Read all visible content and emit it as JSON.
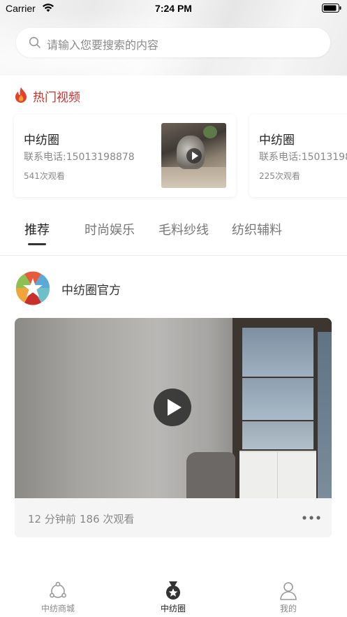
{
  "status_bar": {
    "carrier": "Carrier",
    "time": "7:24 PM"
  },
  "search": {
    "placeholder": "请输入您要搜索的内容"
  },
  "hot_section": {
    "title": "热门视频",
    "cards": [
      {
        "name": "中纺圈",
        "phone": "联系电话:15013198878",
        "views": "541次观看"
      },
      {
        "name": "中纺圈",
        "phone": "联系电话:15013198",
        "views": "225次观看"
      }
    ]
  },
  "tabs": [
    {
      "label": "推荐",
      "active": true
    },
    {
      "label": "时尚娱乐",
      "active": false
    },
    {
      "label": "毛料纱线",
      "active": false
    },
    {
      "label": "纺织辅料",
      "active": false
    }
  ],
  "post": {
    "author": "中纺圈官方",
    "time": "12 分钟前",
    "views": "186 次观看"
  },
  "bottom_nav": [
    {
      "label": "中纺商城",
      "icon": "mall-icon",
      "active": false
    },
    {
      "label": "中纺圈",
      "icon": "medal-icon",
      "active": true
    },
    {
      "label": "我的",
      "icon": "user-icon",
      "active": false
    }
  ],
  "colors": {
    "hot_accent": "#c8302c",
    "text_primary": "#222222",
    "text_secondary": "#888888"
  }
}
